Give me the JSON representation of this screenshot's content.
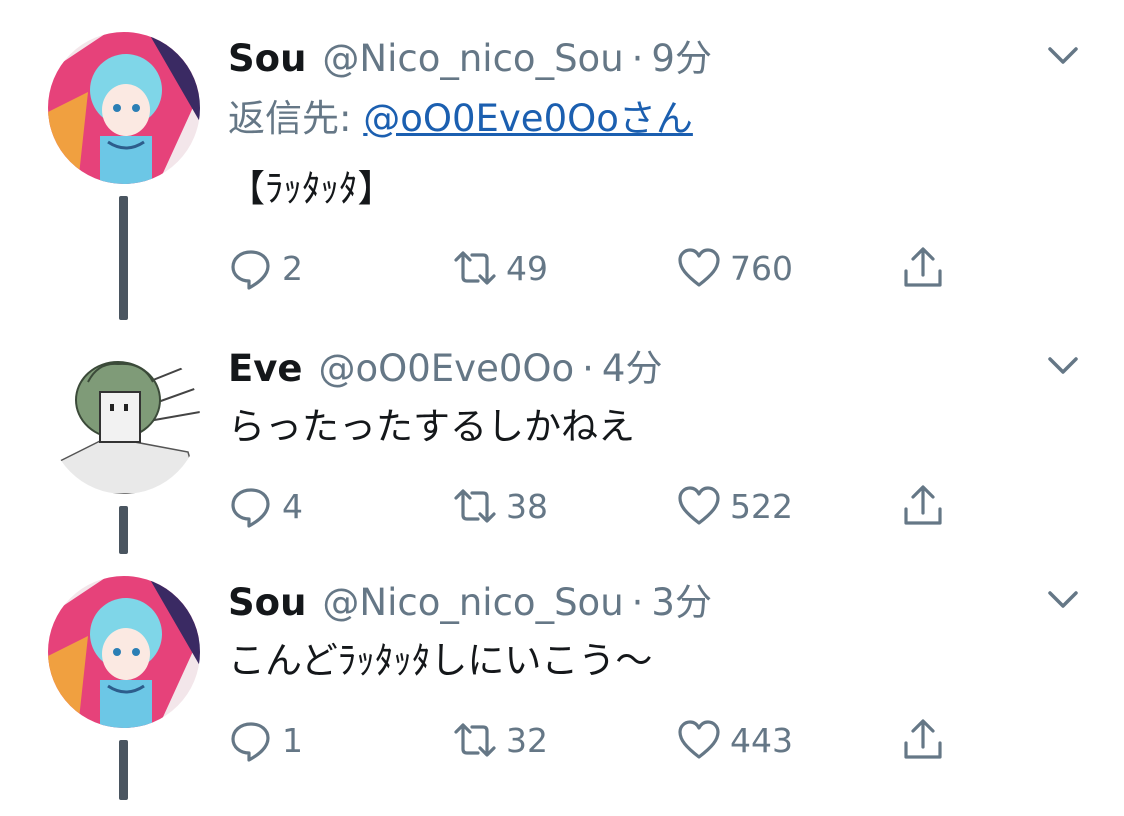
{
  "tweets": [
    {
      "name": "Sou",
      "handle": "@Nico_nico_Sou",
      "dot": "·",
      "time": "9分",
      "reply_prefix": "返信先: ",
      "reply_to": "@oO0Eve0Ooさん",
      "text": "【ﾗｯﾀｯﾀ】",
      "replies": "2",
      "retweets": "49",
      "likes": "760"
    },
    {
      "name": "Eve",
      "handle": "@oO0Eve0Oo",
      "dot": "·",
      "time": "4分",
      "text": "らったったするしかねえ",
      "replies": "4",
      "retweets": "38",
      "likes": "522"
    },
    {
      "name": "Sou",
      "handle": "@Nico_nico_Sou",
      "dot": "·",
      "time": "3分",
      "text": "こんどﾗｯﾀｯﾀしにいこう〜",
      "replies": "1",
      "retweets": "32",
      "likes": "443"
    }
  ],
  "icons": {
    "reply": "reply-icon",
    "retweet": "retweet-icon",
    "like": "heart-icon",
    "share": "share-icon",
    "caret": "chevron-down-icon"
  },
  "colors": {
    "text": "#14171a",
    "secondary": "#657786",
    "link": "#1b5fb0",
    "thread_line": "#4a5560"
  }
}
